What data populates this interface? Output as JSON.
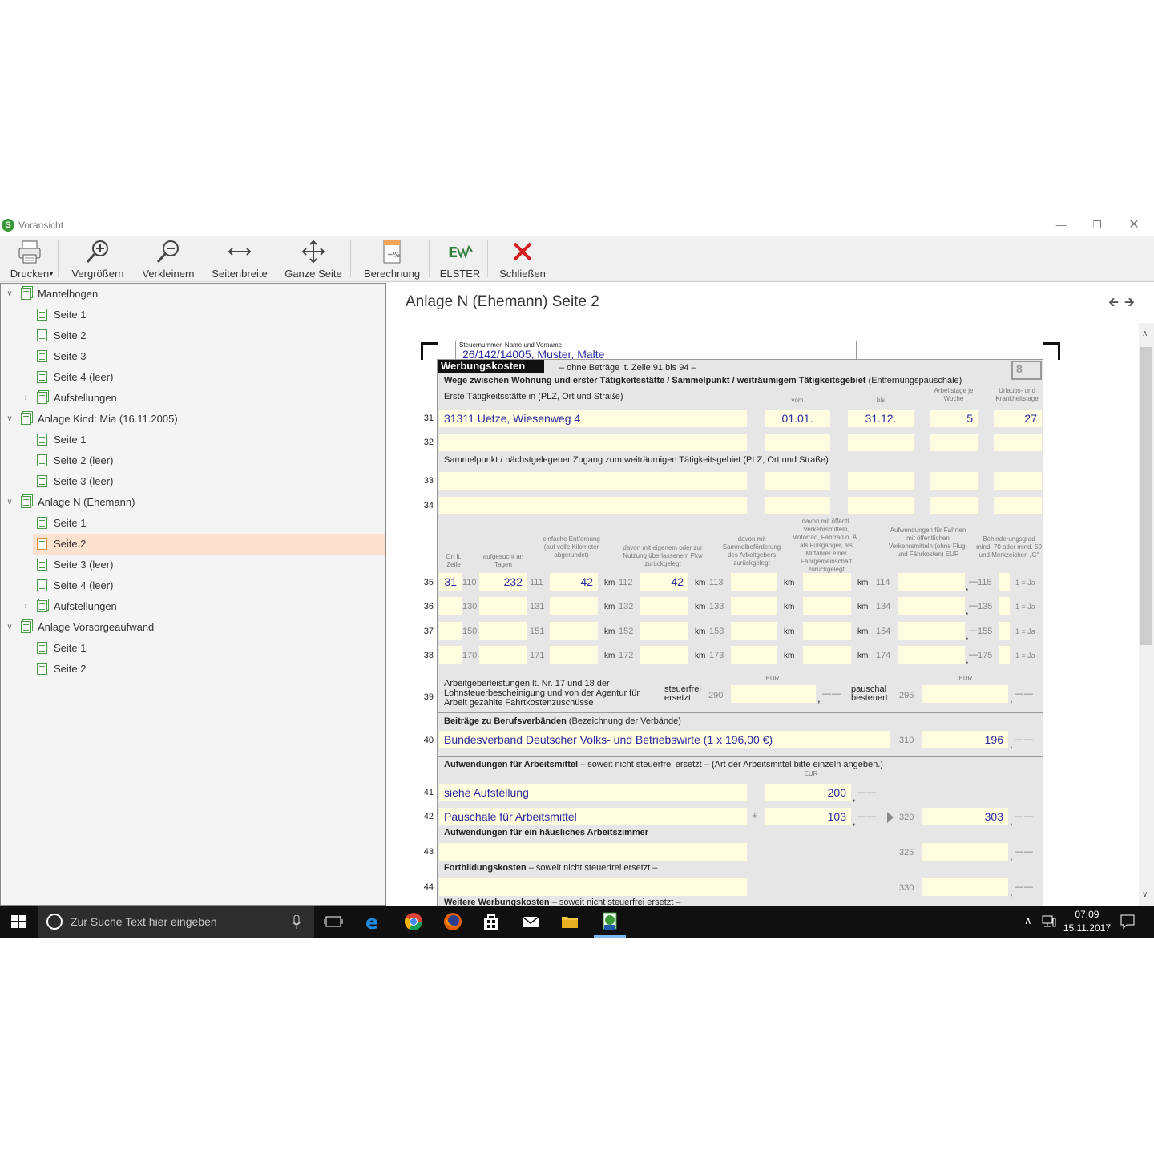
{
  "window": {
    "title": "Voransicht",
    "app_icon": "S"
  },
  "toolbar": {
    "print": "Drucken",
    "zoom_in": "Vergrößern",
    "zoom_out": "Verkleinern",
    "page_width": "Seitenbreite",
    "whole_page": "Ganze Seite",
    "calculation": "Berechnung",
    "elster": "ELSTER",
    "close": "Schließen"
  },
  "tree": {
    "g1": "Mantelbogen",
    "g1_s1": "Seite 1",
    "g1_s2": "Seite 2",
    "g1_s3": "Seite 3",
    "g1_s4": "Seite 4 (leer)",
    "g1_auf": "Aufstellungen",
    "g2": "Anlage Kind: Mia (16.11.2005)",
    "g2_s1": "Seite 1",
    "g2_s2": "Seite 2 (leer)",
    "g2_s3": "Seite 3 (leer)",
    "g3": "Anlage N (Ehemann)",
    "g3_s1": "Seite 1",
    "g3_s2": "Seite 2",
    "g3_s3": "Seite 3 (leer)",
    "g3_s4": "Seite 4 (leer)",
    "g3_auf": "Aufstellungen",
    "g4": "Anlage Vorsorgeaufwand",
    "g4_s1": "Seite 1",
    "g4_s2": "Seite 2"
  },
  "main": {
    "title": "Anlage N (Ehemann) Seite 2"
  },
  "form": {
    "taxno_label": "Steuernummer, Name und Vorname",
    "taxno": "26/142/14005, Muster, Malte",
    "section": "Werbungskosten",
    "section_sub": "– ohne Beträge lt. Zeile 91 bis 94 –",
    "page_no": "8",
    "wege_title": "Wege zwischen Wohnung und erster Tätigkeitsstätte / Sammelpunkt / weiträumigem Tätigkeitsgebiet",
    "wege_suffix": "(Entfernungspauschale)",
    "erste": "Erste Tätigkeitsstätte in (PLZ, Ort und Straße)",
    "h_vom": "vom",
    "h_bis": "bis",
    "h_atage": "Arbeitstage je Woche",
    "h_urlaub": "Urlaubs- und Krankheitstage",
    "r31_addr": "31311 Uetze, Wiesenweg 4",
    "r31_vom": "01.01.",
    "r31_bis": "31.12.",
    "r31_at": "5",
    "r31_ut": "27",
    "sammel": "Sammelpunkt / nächstgelegener Zugang zum weiträumigen Tätigkeitsgebiet (PLZ, Ort und Straße)",
    "h_ort": "Ort lt. Zeile",
    "h_tage": "aufgesucht an Tagen",
    "h_entf": "einfache Entfernung (auf volle Kilometer abgerundet)",
    "h_pkw": "davon mit eigenem oder zur Nutzung überlassenem Pkw zurückgelegt",
    "h_sammel": "davon mit Sammelbeförderung des Arbeitgebers zurückgelegt",
    "h_oeff": "davon mit öffentl. Verkehrsmitteln, Motorrad, Fahrrad o. Ä., als Fußgänger, als Mitfahrer einer Fahrgemeinschaft zurückgelegt",
    "h_aufw": "Aufwendungen für Fahrten mit öffentlichen Verkehrsmitteln (ohne Flug- und Fährkosten) EUR",
    "h_behind": "Behinderungsgrad mind. 70 oder mind. 50 und Merkzeichen „G“",
    "r35_ort": "31",
    "r35_tage": "232",
    "r35_entf": "42",
    "r35_pkw": "42",
    "km": "km",
    "ja": "1 = Ja",
    "c": {
      "a110": "110",
      "a111": "111",
      "a112": "112",
      "a113": "113",
      "a114": "114",
      "a115": "115",
      "a130": "130",
      "a131": "131",
      "a132": "132",
      "a133": "133",
      "a134": "134",
      "a135": "135",
      "a150": "150",
      "a151": "151",
      "a152": "152",
      "a153": "153",
      "a154": "154",
      "a155": "155",
      "a170": "170",
      "a171": "171",
      "a172": "172",
      "a173": "173",
      "a174": "174",
      "a175": "175",
      "a290": "290",
      "a295": "295",
      "a310": "310",
      "a320": "320",
      "a325": "325",
      "a330": "330"
    },
    "eur": "EUR",
    "r39_text": "Arbeitgeberleistungen lt. Nr. 17 und 18 der Lohnsteuerbescheinigung und von der Agentur für Arbeit gezahlte Fahrtkostenzuschüsse",
    "r39_sf": "steuerfrei ersetzt",
    "r39_pb": "pauschal besteuert",
    "berufsv": "Beiträge zu Berufsverbänden",
    "berufsv_sub": "(Bezeichnung der Verbände)",
    "r40_text": "Bundesverband Deutscher Volks- und Betriebswirte (1 x 196,00 €)",
    "r40_val": "196",
    "arbeitsm": "Aufwendungen für Arbeitsmittel",
    "arbeitsm_sub": "– soweit nicht steuerfrei ersetzt – (Art der Arbeitsmittel bitte einzeln angeben.)",
    "r41_text": "siehe Aufstellung",
    "r41_val": "200",
    "r42_text": "Pauschale für Arbeitsmittel",
    "r42_val": "103",
    "r42_sum": "303",
    "plus": "+",
    "zimmer": "Aufwendungen für ein häusliches Arbeitszimmer",
    "fortb": "Fortbildungskosten",
    "fortb_sub": "– soweit nicht steuerfrei ersetzt –",
    "weitere": "Weitere Werbungskosten",
    "weitere_sub": "– soweit nicht steuerfrei ersetzt –",
    "lines": {
      "l31": "31",
      "l32": "32",
      "l33": "33",
      "l34": "34",
      "l35": "35",
      "l36": "36",
      "l37": "37",
      "l38": "38",
      "l39": "39",
      "l40": "40",
      "l41": "41",
      "l42": "42",
      "l43": "43",
      "l44": "44"
    }
  },
  "taskbar": {
    "search_placeholder": "Zur Suche Text hier eingeben",
    "time": "07:09",
    "date": "15.11.2017"
  },
  "colors": {
    "accent_green": "#3a9a3a",
    "close_red": "#d32020",
    "selection": "#fde2cf",
    "field_yellow": "#fffde0",
    "field_text": "#2a2aa0"
  }
}
